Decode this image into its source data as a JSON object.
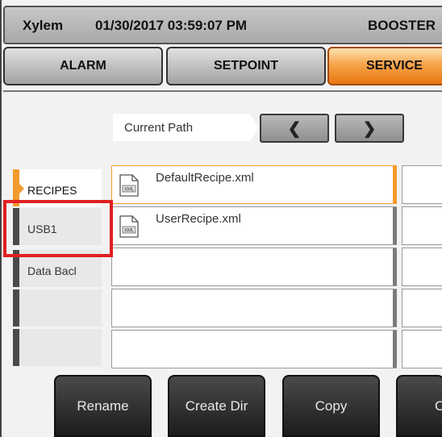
{
  "header": {
    "brand": "Xylem",
    "datetime": "01/30/2017 03:59:07 PM",
    "station": "BOOSTER"
  },
  "tabs": [
    {
      "label": "ALARM",
      "active": false
    },
    {
      "label": "SETPOINT",
      "active": false
    },
    {
      "label": "SERVICE",
      "active": true
    }
  ],
  "path": {
    "label": "Current Path",
    "back_icon": "chevron-left-icon",
    "forward_icon": "chevron-right-icon"
  },
  "sidebar": {
    "items": [
      {
        "label": "RECIPES",
        "active": true
      },
      {
        "label": "USB1",
        "active": false
      },
      {
        "label": "Data  Bacl",
        "active": false
      },
      {
        "label": "",
        "active": false
      },
      {
        "label": "",
        "active": false
      }
    ]
  },
  "files": [
    {
      "name": "DefaultRecipe.xml",
      "icon": "xml-file-icon",
      "selected": true
    },
    {
      "name": "UserRecipe.xml",
      "icon": "xml-file-icon",
      "selected": false
    },
    {
      "name": ""
    },
    {
      "name": ""
    },
    {
      "name": ""
    }
  ],
  "buttons": {
    "rename": "Rename",
    "create_dir": "Create Dir",
    "copy": "Copy",
    "fourth": "C"
  },
  "colors": {
    "accent": "#f39a2d",
    "highlight": "#e02020"
  }
}
